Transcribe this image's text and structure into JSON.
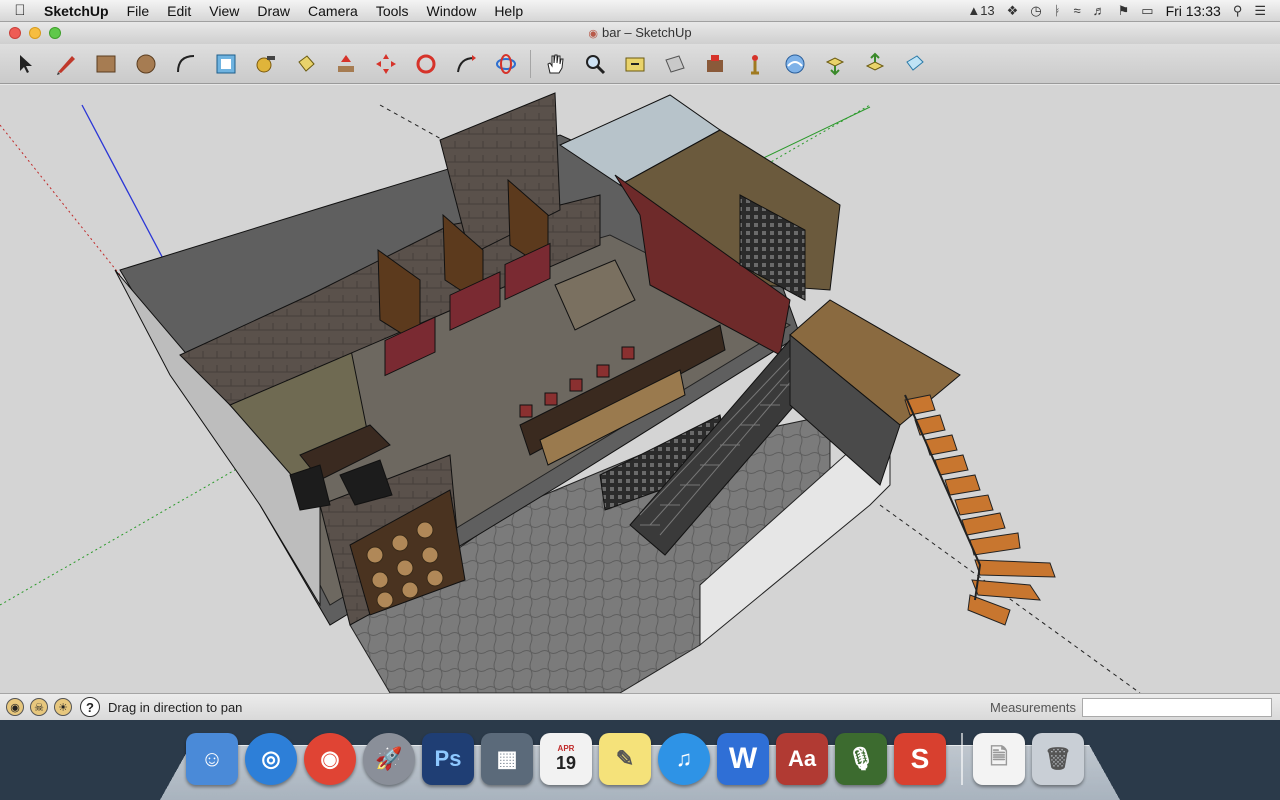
{
  "menubar": {
    "app_name": "SketchUp",
    "menus": [
      "File",
      "Edit",
      "View",
      "Draw",
      "Camera",
      "Tools",
      "Window",
      "Help"
    ],
    "notification_count": "13",
    "clock": "Fri 13:33"
  },
  "window": {
    "title": "bar – SketchUp"
  },
  "toolbar": {
    "tools": [
      "select-tool",
      "pencil-line-tool",
      "rectangle-tool",
      "circle-tool",
      "arc-tool",
      "offset-tool",
      "tape-measure-tool",
      "paint-bucket-tool",
      "push-pull-tool",
      "move-tool",
      "rotate-tool",
      "follow-me-tool",
      "orbit-tool",
      "pan-tool",
      "zoom-tool",
      "zoom-extents-tool",
      "previous-view-tool",
      "next-view-tool",
      "position-camera-tool",
      "walk-tool",
      "get-models-tool",
      "share-model-tool",
      "upload-component-tool",
      "preview-tool"
    ]
  },
  "statusbar": {
    "hint": "Drag in direction to pan",
    "measurements_label": "Measurements",
    "measurements_value": ""
  },
  "dock": {
    "apps": [
      {
        "name": "Finder",
        "label": "☺",
        "color": "#4a8ad8"
      },
      {
        "name": "Safari",
        "label": "◎",
        "color": "#2d7fd8"
      },
      {
        "name": "Chrome",
        "label": "◉",
        "color": "#e04434"
      },
      {
        "name": "Launchpad",
        "label": "🚀",
        "color": "#8a8f99"
      },
      {
        "name": "Photoshop",
        "label": "Ps",
        "color": "#1f3e74"
      },
      {
        "name": "Preview",
        "label": "▦",
        "color": "#5b6a7a"
      },
      {
        "name": "Calendar",
        "label": "19",
        "color": "#f2f2f2"
      },
      {
        "name": "Stickies",
        "label": "✎",
        "color": "#f5e27a"
      },
      {
        "name": "iTunes",
        "label": "♫",
        "color": "#2e93e6"
      },
      {
        "name": "Word",
        "label": "W",
        "color": "#2f6fd6"
      },
      {
        "name": "Dictionary",
        "label": "Aa",
        "color": "#b13a33"
      },
      {
        "name": "Dictation",
        "label": "🎙",
        "color": "#3c6b2f"
      },
      {
        "name": "SketchUp",
        "label": "S",
        "color": "#d8402f"
      }
    ],
    "calendar_month": "APR"
  }
}
